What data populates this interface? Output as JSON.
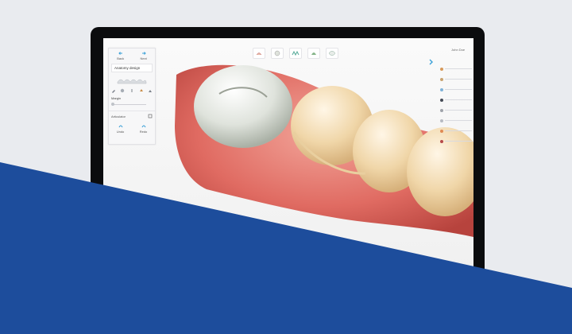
{
  "app": {
    "user_name": "John Doe"
  },
  "left_panel": {
    "nav": [
      {
        "label": "Back",
        "icon": "arrow-left-icon"
      },
      {
        "label": "Next",
        "icon": "arrow-right-icon"
      }
    ],
    "title": "Anatomy design",
    "margin_label": "Margin",
    "articulator_label": "Articulator",
    "history": [
      {
        "label": "Undo",
        "icon": "undo-icon"
      },
      {
        "label": "Redo",
        "icon": "redo-icon"
      }
    ]
  },
  "top_toolbar": {
    "icons": [
      "tooth-view-icon",
      "crown-edit-icon",
      "occlusion-icon",
      "contact-icon",
      "toggle-visibility-icon"
    ]
  },
  "right_panel": {
    "item_colors": [
      "#d79a5a",
      "#c9a36f",
      "#7fb2d8",
      "#444a55",
      "#9fa3aa",
      "#b7bbc2",
      "#e08a55",
      "#b64a4a"
    ]
  },
  "colors": {
    "brand_blue": "#1d4d9c",
    "accent_cyan": "#3aa0d8"
  }
}
